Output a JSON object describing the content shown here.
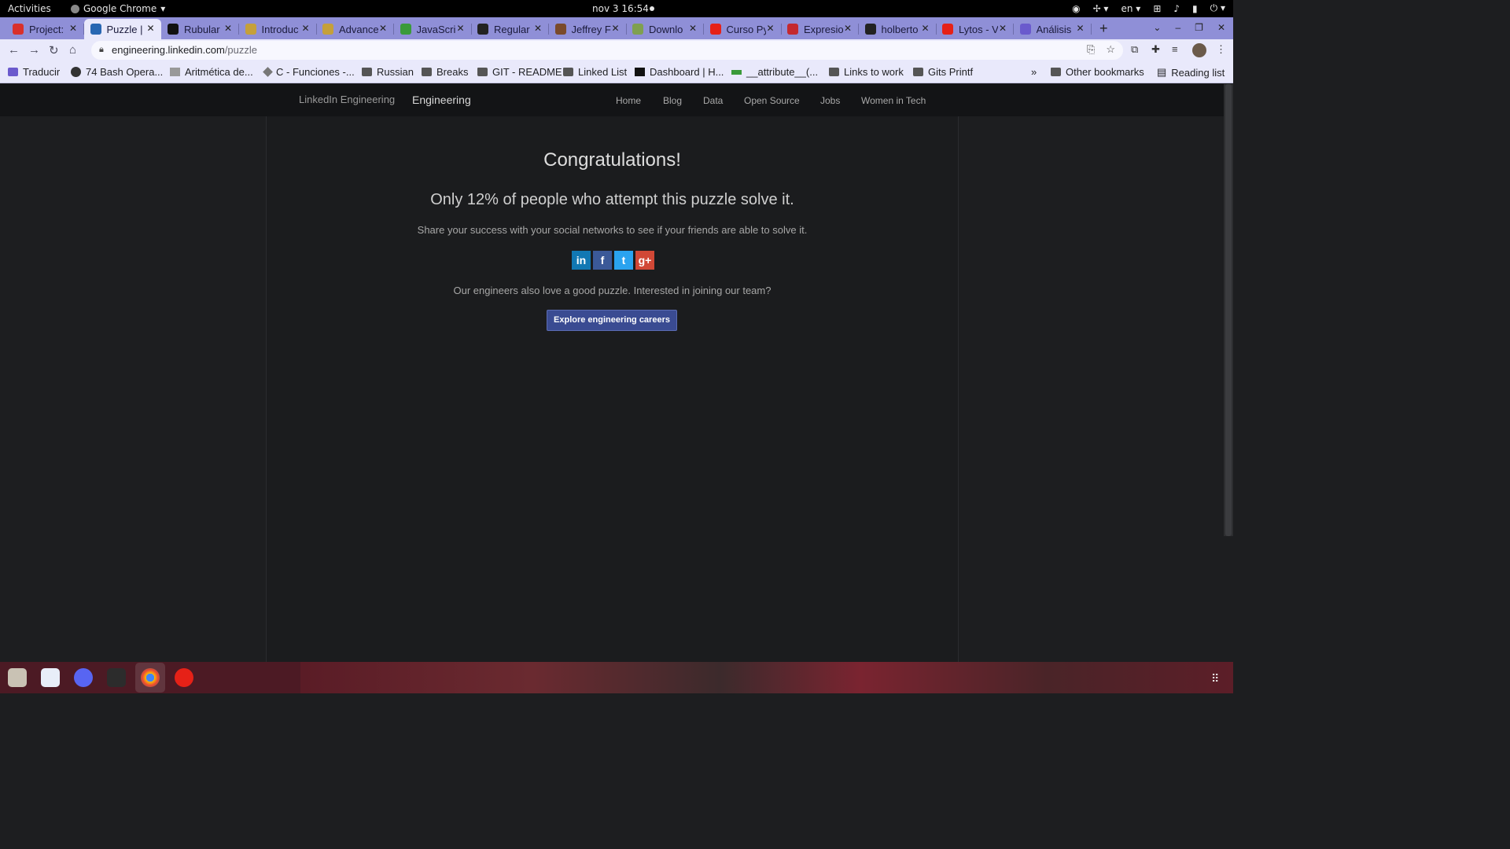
{
  "gnome": {
    "activities": "Activities",
    "app_name": "Google Chrome",
    "clock": "nov 3  16:54",
    "language": "en"
  },
  "tabs": [
    {
      "title": "Project:",
      "color": "#d9302b"
    },
    {
      "title": "Puzzle | L",
      "color": "#2867b2",
      "active": true
    },
    {
      "title": "Rubular",
      "color": "#111111"
    },
    {
      "title": "Introduc",
      "color": "#c5a03a"
    },
    {
      "title": "Advance",
      "color": "#c5a03a"
    },
    {
      "title": "JavaScri",
      "color": "#3a9a3a"
    },
    {
      "title": "Regular",
      "color": "#222222"
    },
    {
      "title": "Jeffrey F",
      "color": "#7a4a2a"
    },
    {
      "title": "Downlo",
      "color": "#7fa050"
    },
    {
      "title": "Curso Py",
      "color": "#e62117"
    },
    {
      "title": "Expresio",
      "color": "#c4282e"
    },
    {
      "title": "holberto",
      "color": "#222222"
    },
    {
      "title": "Lytos - V",
      "color": "#e62117"
    },
    {
      "title": "Análisis",
      "color": "#6a5acd"
    }
  ],
  "address": {
    "host": "engineering.linkedin.com",
    "path": "/puzzle"
  },
  "bookmarks": [
    {
      "label": "Traducir"
    },
    {
      "label": "74 Bash Opera..."
    },
    {
      "label": "Aritmética de..."
    },
    {
      "label": "C - Funciones -..."
    },
    {
      "label": "Russian"
    },
    {
      "label": "Breaks"
    },
    {
      "label": "GIT - README"
    },
    {
      "label": "Linked List"
    },
    {
      "label": "Dashboard | H..."
    },
    {
      "label": "__attribute__(..."
    },
    {
      "label": "Links to work"
    },
    {
      "label": "Gits Printf"
    }
  ],
  "bookmarks_extra": {
    "more": "»",
    "other": "Other bookmarks",
    "reading": "Reading list"
  },
  "site": {
    "logo_alt": "LinkedIn Engineering",
    "brand": "Engineering",
    "nav": [
      "Home",
      "Blog",
      "Data",
      "Open Source",
      "Jobs",
      "Women in Tech"
    ]
  },
  "main": {
    "heading": "Congratulations!",
    "stat": "Only 12% of people who attempt this puzzle solve it.",
    "share_text": "Share your success with your social networks to see if your friends are able to solve it.",
    "social": [
      {
        "name": "LinkedIn",
        "glyph": "in",
        "color": "#1178b3"
      },
      {
        "name": "Facebook",
        "glyph": "f",
        "color": "#3b5998"
      },
      {
        "name": "Twitter",
        "glyph": "t",
        "color": "#2aa3ef"
      },
      {
        "name": "Google+",
        "glyph": "g+",
        "color": "#d14836"
      }
    ],
    "careers_text": "Our engineers also love a good puzzle. Interested in joining our team?",
    "cta": "Explore engineering careers"
  }
}
